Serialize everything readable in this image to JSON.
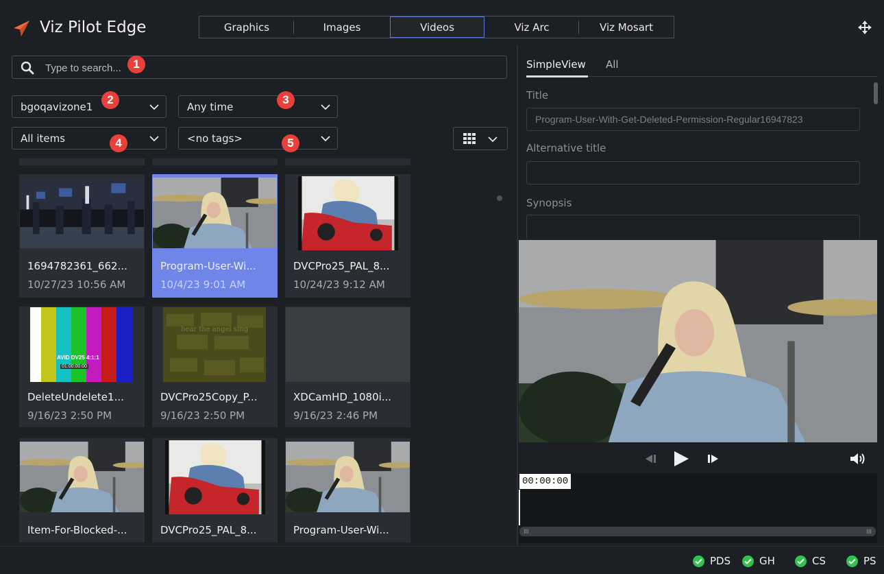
{
  "header": {
    "app_title": "Viz Pilot Edge",
    "tabs": [
      {
        "label": "Graphics",
        "active": false
      },
      {
        "label": "Images",
        "active": false
      },
      {
        "label": "Videos",
        "active": true
      },
      {
        "label": "Viz Arc",
        "active": false
      },
      {
        "label": "Viz Mosart",
        "active": false
      }
    ]
  },
  "colors": {
    "accent": "#5b78d8",
    "selected_card": "#6f86e8",
    "badge": "#e8403a",
    "status_ok": "#33c24d",
    "logo": "#f26a3d"
  },
  "search": {
    "placeholder": "Type to search...",
    "value": ""
  },
  "filters": {
    "source": "bgoqavizone1",
    "time": "Any time",
    "items": "All items",
    "tags": "<no tags>"
  },
  "callouts": [
    "1",
    "2",
    "3",
    "4",
    "5"
  ],
  "view_toggle": {
    "icon": "grid-icon"
  },
  "grid": {
    "items": [
      {
        "name": "1694782361_662...",
        "date": "10/27/23 10:56 AM",
        "thumb": "hockey",
        "selected": false
      },
      {
        "name": "Program-User-Wi...",
        "date": "10/4/23 9:01 AM",
        "thumb": "singer",
        "selected": true
      },
      {
        "name": "DVCPro25_PAL_8...",
        "date": "10/24/23 9:12 AM",
        "thumb": "kart",
        "selected": false
      },
      {
        "name": "DeleteUndelete1...",
        "date": "9/16/23 2:50 PM",
        "thumb": "colorbars",
        "selected": false
      },
      {
        "name": "DVCPro25Copy_P...",
        "date": "9/16/23 2:50 PM",
        "thumb": "wall",
        "selected": false
      },
      {
        "name": "XDCamHD_1080i...",
        "date": "9/16/23 2:46 PM",
        "thumb": "empty",
        "selected": false
      },
      {
        "name": "Item-For-Blocked-...",
        "date": "",
        "thumb": "singer",
        "selected": false
      },
      {
        "name": "DVCPro25_PAL_8...",
        "date": "",
        "thumb": "kart",
        "selected": false
      },
      {
        "name": "Program-User-Wi...",
        "date": "",
        "thumb": "singer",
        "selected": false
      }
    ],
    "colorbars_text_1": "AVID DV25 4:1:1",
    "colorbars_text_2": "01:00:00:00",
    "wall_text": "hear the angel sing"
  },
  "details": {
    "tabs": [
      {
        "label": "SimpleView",
        "active": true
      },
      {
        "label": "All",
        "active": false
      }
    ],
    "fields": [
      {
        "label": "Title",
        "value": "Program-User-With-Get-Deleted-Permission-Regular16947823"
      },
      {
        "label": "Alternative title",
        "value": ""
      },
      {
        "label": "Synopsis",
        "value": ""
      }
    ]
  },
  "player": {
    "timecode": "00:00:00",
    "controls": [
      "step-back-icon",
      "play-icon",
      "step-forward-icon",
      "volume-icon"
    ]
  },
  "status_bar": [
    {
      "label": "PDS",
      "state": "ok"
    },
    {
      "label": "GH",
      "state": "ok"
    },
    {
      "label": "CS",
      "state": "ok"
    },
    {
      "label": "PS",
      "state": "ok"
    }
  ]
}
